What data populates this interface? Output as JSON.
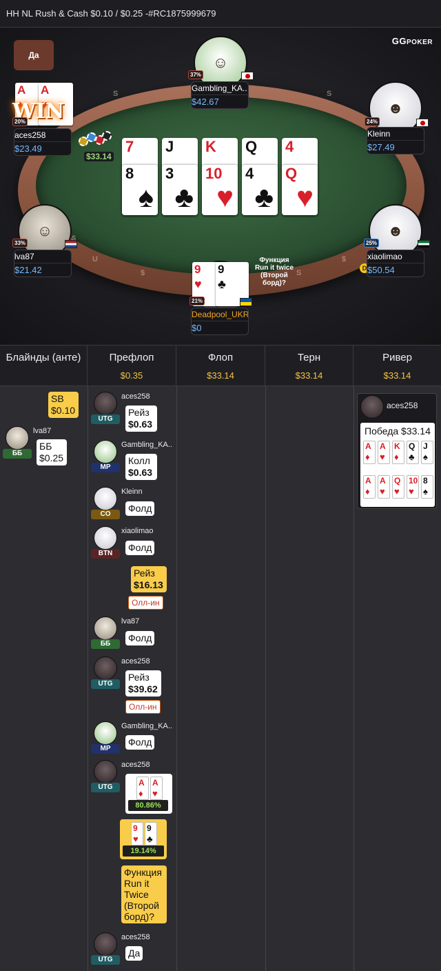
{
  "header": {
    "title": "HH NL Rush & Cash $0.10 / $0.25 -#RC1875999679"
  },
  "logo": {
    "brand": "GG",
    "sub": "POKER"
  },
  "bubble_top": "Да",
  "win_text": "WIN",
  "seats": {
    "gambling": {
      "name": "Gambling_KA..",
      "stack": "$42.67",
      "pct": "37%"
    },
    "kleinn": {
      "name": "Kleinn",
      "stack": "$27.49",
      "pct": "24%"
    },
    "aces": {
      "name": "aces258",
      "stack": "$23.49",
      "pct": "20%"
    },
    "lva": {
      "name": "lva87",
      "stack": "$21.42",
      "pct": "33%"
    },
    "xiao": {
      "name": "xiaolimao",
      "stack": "$50.54",
      "pct": "25%"
    },
    "hero": {
      "name": "Deadpool_UKR",
      "stack": "$0",
      "pct": "21%"
    }
  },
  "dealer_button": "D",
  "pot_amount": "$33.14",
  "run_twice_bubble": "Функция Run it twice (Второй борд)?",
  "board_top": [
    {
      "r": "7",
      "s": "♦"
    },
    {
      "r": "J",
      "s": "♠"
    },
    {
      "r": "K",
      "s": "♦"
    },
    {
      "r": "Q",
      "s": "♠"
    },
    {
      "r": "4",
      "s": "♦"
    }
  ],
  "board_bottom": [
    {
      "r": "8",
      "s": "♠"
    },
    {
      "r": "3",
      "s": "♣"
    },
    {
      "r": "10",
      "s": "♥"
    },
    {
      "r": "4",
      "s": "♣"
    },
    {
      "r": "Q",
      "s": "♥"
    }
  ],
  "hero_cards": [
    {
      "r": "9",
      "s": "♥"
    },
    {
      "r": "9",
      "s": "♣"
    }
  ],
  "aces_cards": [
    {
      "r": "A",
      "s": "♦"
    },
    {
      "r": "A",
      "s": "♥"
    }
  ],
  "rail_letters": [
    "S",
    "S",
    "$",
    "U",
    "$",
    "S",
    "$"
  ],
  "columns": [
    {
      "title": "Блайнды (анте)",
      "value": ""
    },
    {
      "title": "Префлоп",
      "value": "$0.35"
    },
    {
      "title": "Флоп",
      "value": "$33.14"
    },
    {
      "title": "Терн",
      "value": "$33.14"
    },
    {
      "title": "Ривер",
      "value": "$33.14"
    }
  ],
  "blinds": {
    "sb_label": "SB",
    "sb_amount": "$0.10",
    "bb_player": "lva87",
    "bb_pos": "ББ",
    "bb_label": "ББ",
    "bb_amount": "$0.25"
  },
  "preflop": {
    "a1": {
      "name": "aces258",
      "pos": "UTG",
      "act": "Рейз",
      "amt": "$0.63"
    },
    "a2": {
      "name": "Gambling_KA..",
      "pos": "MP",
      "act": "Колл",
      "amt": "$0.63"
    },
    "a3": {
      "name": "Kleinn",
      "pos": "CO",
      "act": "Фолд"
    },
    "a4": {
      "name": "xiaolimao",
      "pos": "BTN",
      "act": "Фолд"
    },
    "a5": {
      "act": "Рейз",
      "amt": "$16.13",
      "allin": "Олл-ин"
    },
    "a6": {
      "name": "lva87",
      "pos": "ББ",
      "act": "Фолд"
    },
    "a7": {
      "name": "aces258",
      "pos": "UTG",
      "act": "Рейз",
      "amt": "$39.62",
      "allin": "Олл-ин"
    },
    "a8": {
      "name": "Gambling_KA..",
      "pos": "MP",
      "act": "Фолд"
    },
    "a9": {
      "name": "aces258",
      "pos": "UTG",
      "equity": "80.86%"
    },
    "a10": {
      "equity": "19.14%"
    },
    "a11": {
      "text": "Функция Run it Twice (Второй борд)?"
    },
    "a12": {
      "name": "aces258",
      "pos": "UTG",
      "act": "Да"
    }
  },
  "river": {
    "name": "aces258",
    "win": "Победа $33.14",
    "row1": [
      {
        "r": "A",
        "s": "♦"
      },
      {
        "r": "A",
        "s": "♥"
      },
      {
        "r": "K",
        "s": "♦"
      },
      {
        "r": "Q",
        "s": "♣"
      },
      {
        "r": "J",
        "s": "♠"
      }
    ],
    "row2": [
      {
        "r": "A",
        "s": "♦"
      },
      {
        "r": "A",
        "s": "♥"
      },
      {
        "r": "Q",
        "s": "♥"
      },
      {
        "r": "10",
        "s": "♥"
      },
      {
        "r": "8",
        "s": "♠"
      }
    ]
  },
  "colors": {
    "accent": "#f5c242",
    "stack": "#74b9ff",
    "hero_name": "#f5a623",
    "equity": "#9be15d"
  }
}
